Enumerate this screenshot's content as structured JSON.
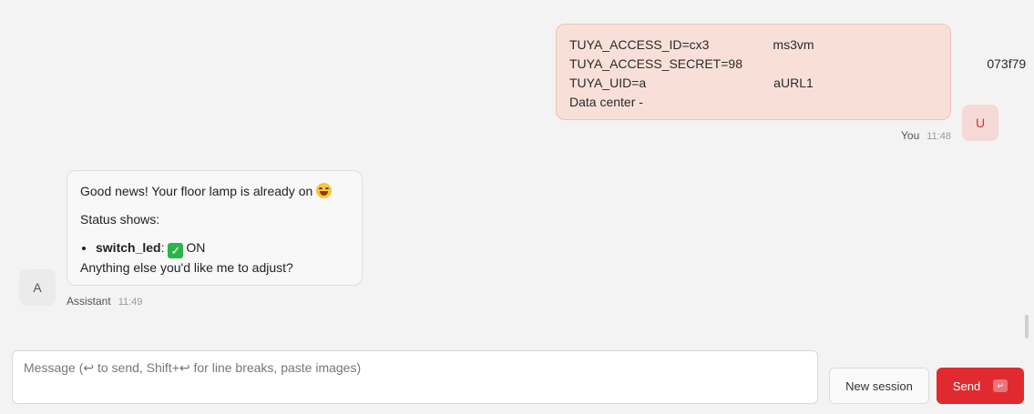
{
  "conversation": {
    "user_message": {
      "lines": [
        "TUYA_ACCESS_ID=cx3                  ms3vm",
        "TUYA_ACCESS_SECRET=98                                                                     073f79",
        "TUYA_UID=a                                    aURL1",
        "Data center - "
      ],
      "sender": "You",
      "time": "11:48",
      "avatar_letter": "U"
    },
    "assistant_message": {
      "greeting": "Good news! Your floor lamp is already on ",
      "status_heading": "Status shows:",
      "status_key": "switch_led",
      "status_sep": ": ",
      "status_value": "ON",
      "follow_up": "Anything else you'd like me to adjust?",
      "sender": "Assistant",
      "time": "11:49",
      "avatar_letter": "A"
    }
  },
  "input": {
    "placeholder": "Message (↩ to send, Shift+↩ for line breaks, paste images)",
    "value": ""
  },
  "buttons": {
    "new_session": "New session",
    "send": "Send",
    "send_shortcut": "↵"
  },
  "icons": {
    "laugh": "tears-of-joy-emoji-icon",
    "check": "check-mark-icon"
  },
  "colors": {
    "accent": "#e02a2f",
    "user_bubble": "#f8e0d8",
    "user_avatar_text": "#d8313a"
  }
}
